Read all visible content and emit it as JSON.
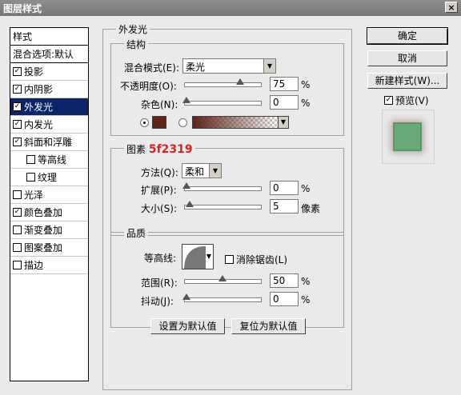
{
  "window": {
    "title": "图层样式",
    "close": "×"
  },
  "left_panel": {
    "header": "样式",
    "blend_options": "混合选项:默认",
    "items": [
      {
        "label": "投影",
        "checked": true,
        "sub": false,
        "selected": false
      },
      {
        "label": "内阴影",
        "checked": true,
        "sub": false,
        "selected": false
      },
      {
        "label": "外发光",
        "checked": true,
        "sub": false,
        "selected": true
      },
      {
        "label": "内发光",
        "checked": true,
        "sub": false,
        "selected": false
      },
      {
        "label": "斜面和浮雕",
        "checked": true,
        "sub": false,
        "selected": false
      },
      {
        "label": "等高线",
        "checked": false,
        "sub": true,
        "selected": false
      },
      {
        "label": "纹理",
        "checked": false,
        "sub": true,
        "selected": false
      },
      {
        "label": "光泽",
        "checked": false,
        "sub": false,
        "selected": false
      },
      {
        "label": "颜色叠加",
        "checked": true,
        "sub": false,
        "selected": false
      },
      {
        "label": "渐变叠加",
        "checked": false,
        "sub": false,
        "selected": false
      },
      {
        "label": "图案叠加",
        "checked": false,
        "sub": false,
        "selected": false
      },
      {
        "label": "描边",
        "checked": false,
        "sub": false,
        "selected": false
      }
    ]
  },
  "outer_glow": {
    "title": "外发光",
    "structure": {
      "title": "结构",
      "blend_mode_label": "混合模式(E):",
      "blend_mode_value": "柔光",
      "opacity_label": "不透明度(O):",
      "opacity_value": "75",
      "noise_label": "杂色(N):",
      "noise_value": "0",
      "percent": "%",
      "color_hex": "#5f2319"
    },
    "elements": {
      "title": "图素",
      "color_annotation": "5f2319",
      "technique_label": "方法(Q):",
      "technique_value": "柔和",
      "spread_label": "扩展(P):",
      "spread_value": "0",
      "size_label": "大小(S):",
      "size_value": "5",
      "percent": "%",
      "size_unit": "像素"
    },
    "quality": {
      "title": "品质",
      "contour_label": "等高线:",
      "antialias_label": "消除锯齿(L)",
      "antialias_checked": false,
      "range_label": "范围(R):",
      "range_value": "50",
      "jitter_label": "抖动(J):",
      "jitter_value": "0",
      "percent": "%"
    },
    "buttons": {
      "make_default": "设置为默认值",
      "reset_default": "复位为默认值"
    },
    "slider_levels": {
      "opacity": 0.75,
      "noise": 0,
      "spread": 0,
      "size": 0.05,
      "range": 0.5,
      "jitter": 0
    }
  },
  "right_panel": {
    "ok": "确定",
    "cancel": "取消",
    "new_style": "新建样式(W)...",
    "preview_label": "预览(V)",
    "preview_checked": true
  }
}
